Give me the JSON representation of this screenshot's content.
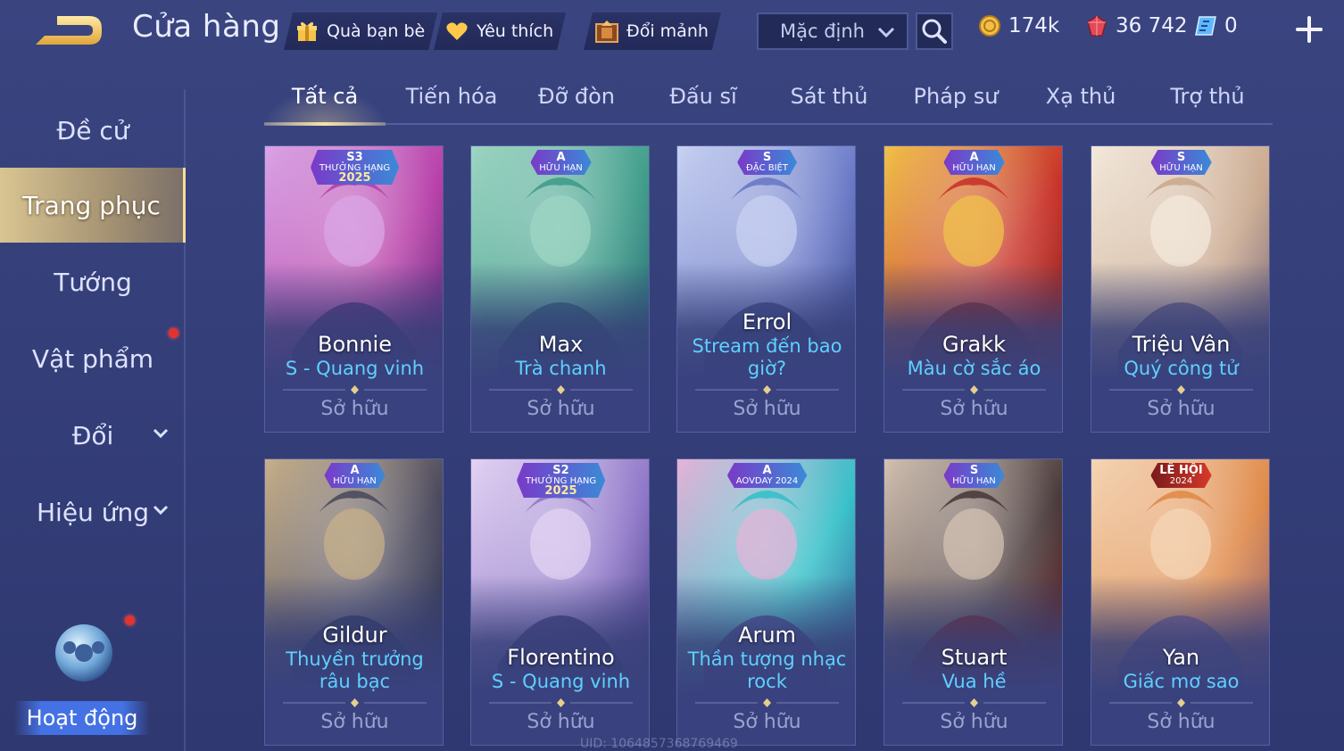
{
  "header": {
    "title": "Cửa hàng",
    "buttons": [
      {
        "label": "Quà bạn bè",
        "icon": "gift-icon"
      },
      {
        "label": "Yêu thích",
        "icon": "heart-icon"
      },
      {
        "label": "Đổi mảnh",
        "icon": "shard-chest-icon"
      }
    ],
    "sort": {
      "value": "Mặc định"
    },
    "currencies": [
      {
        "icon": "gold-coin-icon",
        "value": "174k"
      },
      {
        "icon": "ruby-gem-icon",
        "value": "36 742"
      },
      {
        "icon": "voucher-icon",
        "value": "0"
      }
    ]
  },
  "sidebar": {
    "items": [
      {
        "label": "Đề cử"
      },
      {
        "label": "Trang phục"
      },
      {
        "label": "Tướng"
      },
      {
        "label": "Vật phẩm"
      },
      {
        "label": "Đổi"
      },
      {
        "label": "Hiệu ứng"
      }
    ],
    "activity": {
      "label": "Hoạt động"
    }
  },
  "tabs": [
    {
      "label": "Tất cả"
    },
    {
      "label": "Tiến hóa"
    },
    {
      "label": "Đỡ đòn"
    },
    {
      "label": "Đấu sĩ"
    },
    {
      "label": "Sát thủ"
    },
    {
      "label": "Pháp sư"
    },
    {
      "label": "Xạ thủ"
    },
    {
      "label": "Trợ thủ"
    }
  ],
  "cards": [
    {
      "hero": "Bonnie",
      "skin": "S - Quang vinh",
      "status": "Sở hữu",
      "badge": {
        "tier": "S3",
        "line1": "THƯỞNG HẠNG",
        "line2": "2025"
      },
      "colors": [
        "#b83fa8",
        "#d9a5e6",
        "#3b2a6e"
      ]
    },
    {
      "hero": "Max",
      "skin": "Trà chanh",
      "status": "Sở hữu",
      "badge": {
        "tier": "A",
        "line1": "HỮU HẠN"
      },
      "colors": [
        "#3f9c8a",
        "#9ed6c3",
        "#245a70"
      ]
    },
    {
      "hero": "Errol",
      "skin": "Stream đến bao giờ?",
      "status": "Sở hữu",
      "badge": {
        "tier": "S",
        "line1": "ĐẶC BIỆT"
      },
      "colors": [
        "#6a79c7",
        "#c8d2f2",
        "#2d3b7a"
      ]
    },
    {
      "hero": "Grakk",
      "skin": "Màu cờ sắc áo",
      "status": "Sở hữu",
      "badge": {
        "tier": "A",
        "line1": "HỮU HẠN"
      },
      "colors": [
        "#c8332a",
        "#f0c24a",
        "#7a1f1a"
      ]
    },
    {
      "hero": "Triệu Vân",
      "skin": "Quý công tử",
      "status": "Sở hữu",
      "badge": {
        "tier": "S",
        "line1": "HỮU HẠN"
      },
      "colors": [
        "#caa98f",
        "#f3e9dc",
        "#54507c"
      ]
    },
    {
      "hero": "Gildur",
      "skin": "Thuyền trưởng râu bạc",
      "status": "Sở hữu",
      "badge": {
        "tier": "A",
        "line1": "HỮU HẠN"
      },
      "colors": [
        "#4c4a5e",
        "#c7b08a",
        "#263056"
      ]
    },
    {
      "hero": "Florentino",
      "skin": "S - Quang vinh",
      "status": "Sở hữu",
      "badge": {
        "tier": "S2",
        "line1": "THƯỞNG HẠNG",
        "line2": "2025"
      },
      "colors": [
        "#8e76c8",
        "#e3d3f3",
        "#2f2f6e"
      ]
    },
    {
      "hero": "Arum",
      "skin": "Thần tượng nhạc rock",
      "status": "Sở hữu",
      "badge": {
        "tier": "A",
        "line1": "AOVDAY 2024"
      },
      "colors": [
        "#35c0c8",
        "#e6b3d8",
        "#4a3d8a"
      ]
    },
    {
      "hero": "Stuart",
      "skin": "Vua hề",
      "status": "Sở hữu",
      "badge": {
        "tier": "S",
        "line1": "HỮU HẠN"
      },
      "colors": [
        "#4a3b3c",
        "#d3c2b2",
        "#7a1e22"
      ]
    },
    {
      "hero": "Yan",
      "skin": "Giấc mơ sao",
      "status": "Sở hữu",
      "badge": {
        "tier": "LỄ HỘI",
        "line1": "2024"
      },
      "colors": [
        "#e08a4a",
        "#f4d6b6",
        "#6b5a9a"
      ]
    }
  ],
  "footer": {
    "watermark": "UID: 1064857368769469"
  },
  "theme": {
    "accent_gold": "#f6e3a8",
    "skin_name": "#5fd0ff",
    "bg": "#353f7a"
  }
}
